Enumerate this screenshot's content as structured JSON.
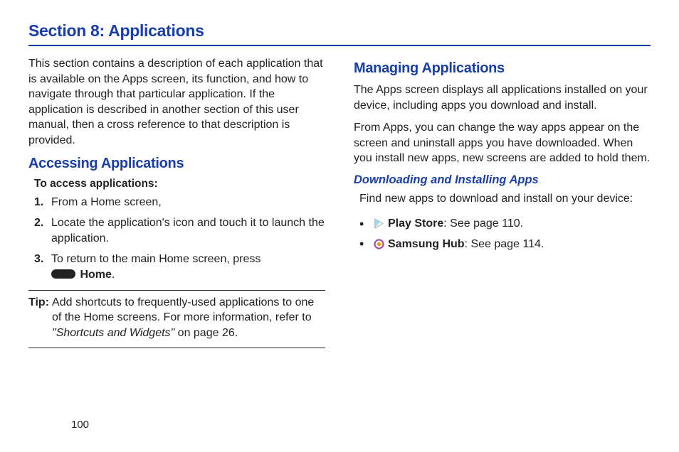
{
  "section_title": "Section 8: Applications",
  "left": {
    "intro": "This section contains a description of each application that is available on the Apps screen, its function, and how to navigate through that particular application. If the application is described in another section of this user manual, then a cross reference to that description is provided.",
    "h2": "Accessing Applications",
    "to_access": "To access applications:",
    "steps": [
      {
        "num": "1.",
        "text": "From a Home screen,"
      },
      {
        "num": "2.",
        "text": "Locate the application's icon and touch it to launch the application."
      },
      {
        "num": "3.",
        "text_pre": "To return to the main Home screen, press ",
        "home_label": "Home",
        "text_post": "."
      }
    ],
    "tip_label": "Tip:",
    "tip_body_pre": "Add shortcuts to frequently-used applications to one of the Home screens. For more information, refer to ",
    "tip_ref": "\"Shortcuts and Widgets\"",
    "tip_body_post": " on page 26."
  },
  "right": {
    "h2": "Managing Applications",
    "p1": "The Apps screen displays all applications installed on your device, including apps you download and install.",
    "p2": "From Apps, you can change the way apps appear on the screen and uninstall apps you have downloaded. When you install new apps, new screens are added to hold them.",
    "h3": "Downloading and Installing Apps",
    "p3": "Find new apps to download and install on your device:",
    "items": [
      {
        "name": "Play Store",
        "ref": ": See page 110."
      },
      {
        "name": "Samsung Hub",
        "ref": ": See page 114."
      }
    ]
  },
  "page_number": "100"
}
